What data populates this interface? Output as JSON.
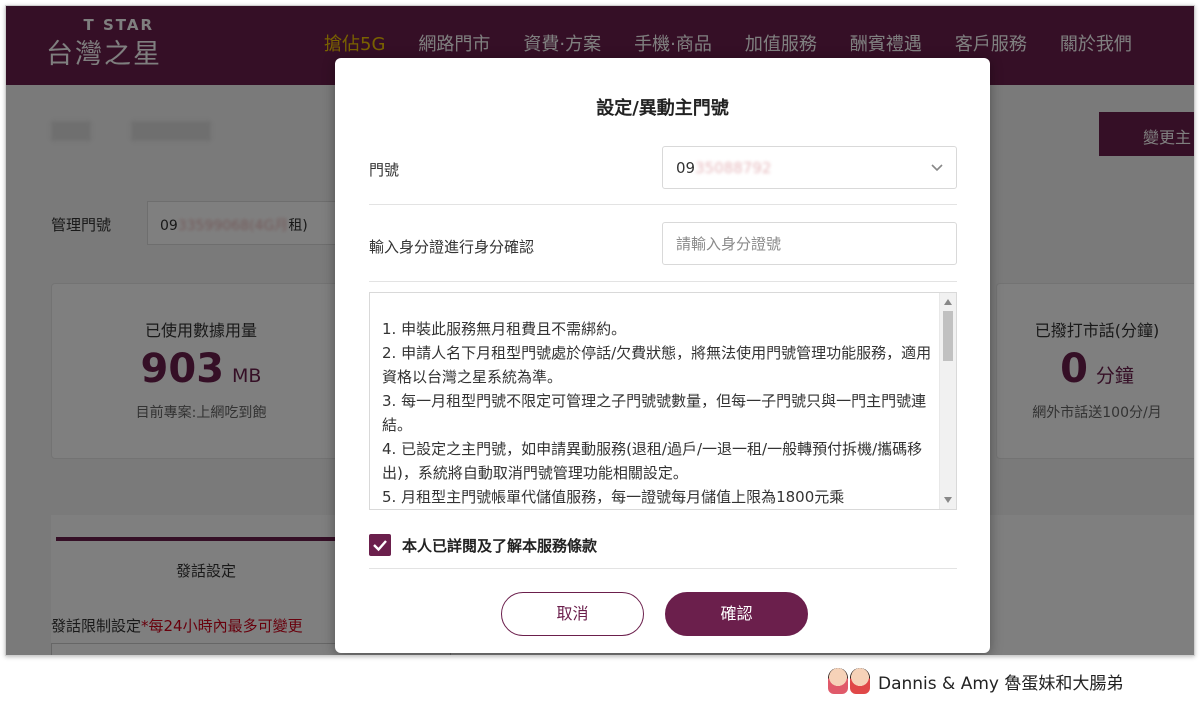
{
  "header": {
    "logo_small": "T STAR",
    "logo_main": "台灣之星",
    "nav": [
      {
        "label": "搶佔5G",
        "active": true
      },
      {
        "label": "網路門市",
        "active": false
      },
      {
        "label": "資費·方案",
        "active": false
      },
      {
        "label": "手機·商品",
        "active": false
      },
      {
        "label": "加值服務",
        "active": false
      },
      {
        "label": "酬賓禮遇",
        "active": false
      },
      {
        "label": "客戶服務",
        "active": false
      },
      {
        "label": "關於我們",
        "active": false
      }
    ]
  },
  "background": {
    "change_button": "變更主",
    "manage_label": "管理門號",
    "manage_select_prefix": "09",
    "manage_select_masked": "33599068(4G月",
    "manage_select_suffix": "租)",
    "card_left": {
      "title": "已使用數據用量",
      "value": "903",
      "unit": "MB",
      "sub": "目前專案:上網吃到飽"
    },
    "card_right": {
      "title": "已撥打市話(分鐘)",
      "value": "0",
      "unit": "分鐘",
      "sub": "網外市話送100分/月"
    },
    "tab_label": "發話設定",
    "restrict_label": "發話限制設定",
    "restrict_note": "*每24小時內最多可變更"
  },
  "modal": {
    "title": "設定/異動主門號",
    "number_label": "門號",
    "number_prefix": "09",
    "number_masked": "35088792",
    "id_label": "輸入身分證進行身分確認",
    "id_placeholder": "請輸入身分證號",
    "terms": [
      "1. 申裝此服務無月租費且不需綁約。",
      "2. 申請人名下月租型門號處於停話/欠費狀態，將無法使用門號管理功能服務，適用資格以台灣之星系統為準。",
      "3. 每一月租型門號不限定可管理之子門號號數量，但每一子門號只與一門主門號連結。",
      "4. 已設定之主門號，如申請異動服務(退租/過戶/一退一租/一般轉預付拆機/攜碼移出)，系統將自動取消門號管理功能相關設定。",
      "5. 月租型主門號帳單代儲值服務，每一證號每月儲值上限為1800元乘"
    ],
    "agree_checked": true,
    "agree_label": "本人已詳閱及了解本服務條款",
    "cancel_label": "取消",
    "confirm_label": "確認"
  },
  "watermark": {
    "text": "Dannis & Amy 魯蛋妹和大腸弟"
  },
  "colors": {
    "brand": "#6b1f4c",
    "nav_active": "#f2c300"
  }
}
